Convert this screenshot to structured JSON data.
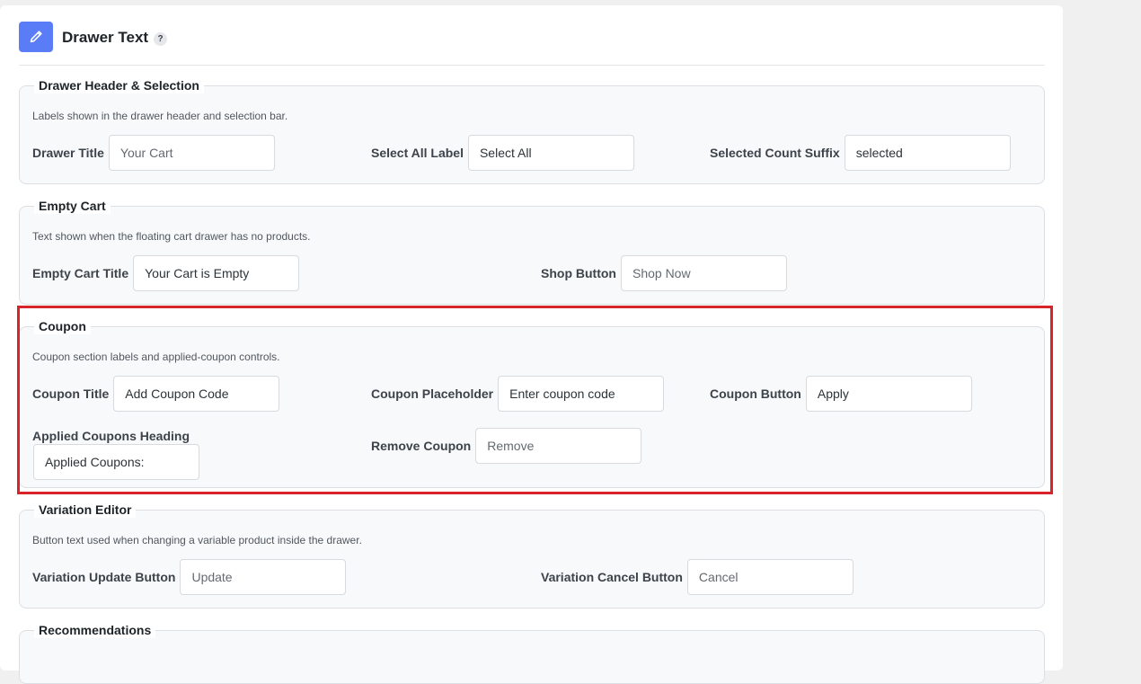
{
  "header": {
    "title": "Drawer Text",
    "help": "?"
  },
  "sections": {
    "drawer_header": {
      "legend": "Drawer Header & Selection",
      "description": "Labels shown in the drawer header and selection bar.",
      "fields": [
        {
          "label": "Drawer Title",
          "value": "",
          "placeholder": "Your Cart"
        },
        {
          "label": "Select All Label",
          "value": "Select All",
          "placeholder": ""
        },
        {
          "label": "Selected Count Suffix",
          "value": "selected",
          "placeholder": ""
        }
      ]
    },
    "empty_cart": {
      "legend": "Empty Cart",
      "description": "Text shown when the floating cart drawer has no products.",
      "fields": [
        {
          "label": "Empty Cart Title",
          "value": "Your Cart is Empty",
          "placeholder": ""
        },
        {
          "label": "Shop Button",
          "value": "",
          "placeholder": "Shop Now"
        }
      ]
    },
    "coupon": {
      "legend": "Coupon",
      "description": "Coupon section labels and applied-coupon controls.",
      "fields": [
        {
          "label": "Coupon Title",
          "value": "Add Coupon Code",
          "placeholder": ""
        },
        {
          "label": "Coupon Placeholder",
          "value": "Enter coupon code",
          "placeholder": ""
        },
        {
          "label": "Coupon Button",
          "value": "Apply",
          "placeholder": ""
        },
        {
          "label": "Applied Coupons Heading",
          "value": "Applied Coupons:",
          "placeholder": ""
        },
        {
          "label": "Remove Coupon",
          "value": "",
          "placeholder": "Remove"
        }
      ]
    },
    "variation_editor": {
      "legend": "Variation Editor",
      "description": "Button text used when changing a variable product inside the drawer.",
      "fields": [
        {
          "label": "Variation Update Button",
          "value": "",
          "placeholder": "Update"
        },
        {
          "label": "Variation Cancel Button",
          "value": "",
          "placeholder": "Cancel"
        }
      ]
    },
    "recommendations": {
      "legend": "Recommendations"
    }
  },
  "colors": {
    "accent": "#5b7cf7",
    "highlight": "#d8232a"
  }
}
